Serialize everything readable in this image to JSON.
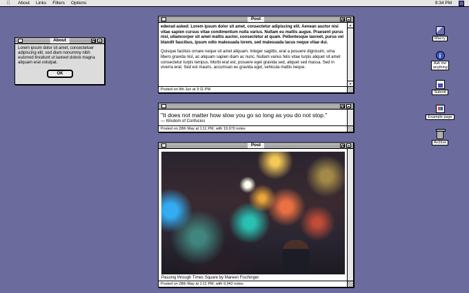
{
  "menubar": {
    "apple_icon": "apple-logo-icon",
    "items": [
      "About",
      "Links",
      "Filters",
      "Options"
    ],
    "clock": "9:34 PM"
  },
  "about_window": {
    "title": "About",
    "text": "Lorem ipsum dolor sit amet, consectetuer adipiscing elit, sed diam nonummy nibh euismod tincidunt ut laoreet dolore magna aliquam erat volutpat.",
    "ok_label": "OK"
  },
  "posts": [
    {
      "title": "Post",
      "question": "edwrad asked: Lorem ipsum dolor sit amet, consectetur adipiscing elit. Aenean auctor nisi vitae sapien cursus vitae condimentum nulla varius. Nullam eu mattis augue. Praesent purus nisl, ullamcorper sit amet mattis auctor, consectetur at quam. Pellentesque laoreet, purus vel blandit faucibus, ipsum odio malesuada lorem, sed malesuada lacus neque vitae dui.",
      "answer": "Quisque facilisis ornare neque sit amet aliquam. Integer sagittis, erat a posuere dignissim, urna libero gravida nisl, ac aliquam sapien diam ac nunc. Nullam varius felis vitae turpis aliquet sit amet consectetur turpis tempus. Morbi erat est, posuere eget gravida sed, aliquet sed massa. Sed in viverra erat. Sed est mauris, accumsan eu gravida eget, vehicula mattis neque.",
      "footer": "Posted on 9th Jun at 3:11 PM"
    },
    {
      "quote": "\"It does not matter how slow you go so long as you do not stop.\"",
      "source": "— Wisdom of Confucius",
      "footer": "Posted on 28th May at 1:11 PM, with 19,970 notes"
    },
    {
      "title": "Post",
      "caption": "Passing through Times Square by Mareen Fischinger",
      "footer": "Posted on 28th May at 1:11 PM, with 9,942 notes"
    }
  ],
  "desktop_icons": [
    {
      "label": "Maccy",
      "icon": "robot-icon"
    },
    {
      "label": "Ask me anything",
      "icon": "info-icon"
    },
    {
      "label": "Submit",
      "icon": "submit-icon"
    },
    {
      "label": "Example page",
      "icon": "page-icon"
    },
    {
      "label": "Archive",
      "icon": "trash-icon"
    }
  ]
}
